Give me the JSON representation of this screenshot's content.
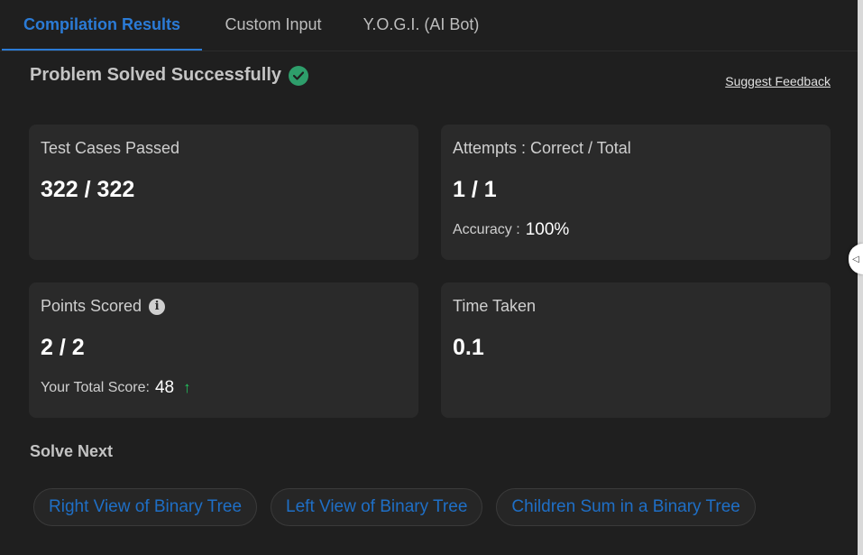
{
  "tabs": [
    {
      "label": "Compilation Results",
      "active": true
    },
    {
      "label": "Custom Input",
      "active": false
    },
    {
      "label": "Y.O.G.I. (AI Bot)",
      "active": false
    }
  ],
  "status": {
    "title": "Problem Solved Successfully",
    "icon": "check-circle-icon",
    "color": "#2e9e6b"
  },
  "feedback_link": "Suggest Feedback",
  "cards": {
    "test_cases": {
      "label": "Test Cases Passed",
      "value": "322 / 322"
    },
    "attempts": {
      "label": "Attempts : Correct / Total",
      "value": "1 / 1",
      "sub_label": "Accuracy :",
      "sub_value": "100%"
    },
    "points": {
      "label": "Points Scored",
      "value": "2 / 2",
      "sub_label": "Your Total Score:",
      "sub_value": "48"
    },
    "time": {
      "label": "Time Taken",
      "value": "0.1"
    }
  },
  "solve_next": {
    "title": "Solve Next",
    "items": [
      "Right View of Binary Tree",
      "Left View of Binary Tree",
      "Children Sum in a Binary Tree"
    ]
  },
  "colors": {
    "accent": "#2b7bd6",
    "background": "#1f1f1f",
    "card": "#2a2a2a",
    "score_up": "#22c55e"
  }
}
